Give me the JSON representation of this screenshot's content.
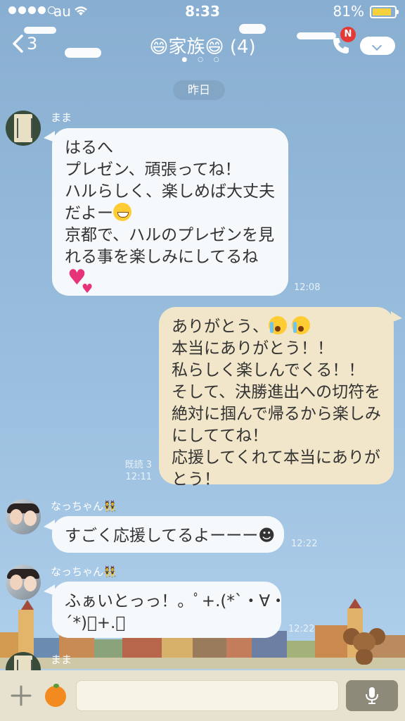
{
  "status_bar": {
    "carrier": "au",
    "time": "8:33",
    "battery_percent": "81%",
    "battery_level": 0.81
  },
  "header": {
    "back_count": "3",
    "title": "😄家族😄 (4)",
    "page_dots": "● ○ ○",
    "notification_badge": "N"
  },
  "date_separator": "昨日",
  "messages": [
    {
      "sender": "まま",
      "direction": "incoming",
      "lines": [
        "はるへ",
        "プレゼン、頑張ってね！",
        "ハルらしく、楽しめば大丈夫",
        "だよー",
        "京都で、ハルのプレゼンを見",
        "れる事を楽しみにしてるね"
      ],
      "time": "12:08"
    },
    {
      "direction": "outgoing",
      "lines": [
        "ありがとう、",
        "本当にありがとう！！",
        "私らしく楽しんでくる！！",
        "そして、決勝進出への切符を",
        "絶対に掴んで帰るから楽しみ",
        "にしててね！",
        "応援してくれて本当にありが",
        "とう！"
      ],
      "read": "既読 3",
      "time": "12:11"
    },
    {
      "sender": "なっちゃん👯",
      "direction": "incoming",
      "lines": [
        "すごく応援してるよーーー☻"
      ],
      "time": "12:22"
    },
    {
      "sender": "なっちゃん👯",
      "direction": "incoming",
      "lines": [
        "ふぁいとっっ！。ﾟ+.(*`・∀・",
        "´*)ﾟ+.ﾟ"
      ],
      "time": "12:22"
    },
    {
      "sender": "まま",
      "direction": "incoming",
      "lines": [],
      "time": ""
    }
  ],
  "input_bar": {
    "placeholder": ""
  },
  "icons": [
    "back-chevron-icon",
    "phone-icon",
    "menu-chevron-icon",
    "plus-icon",
    "sticker-orange-icon",
    "mic-icon"
  ],
  "colors": {
    "background": "#9dc1e0",
    "incoming_bubble": "#f6f9fb",
    "outgoing_bubble": "#f1e6c9",
    "badge": "#e53935"
  }
}
